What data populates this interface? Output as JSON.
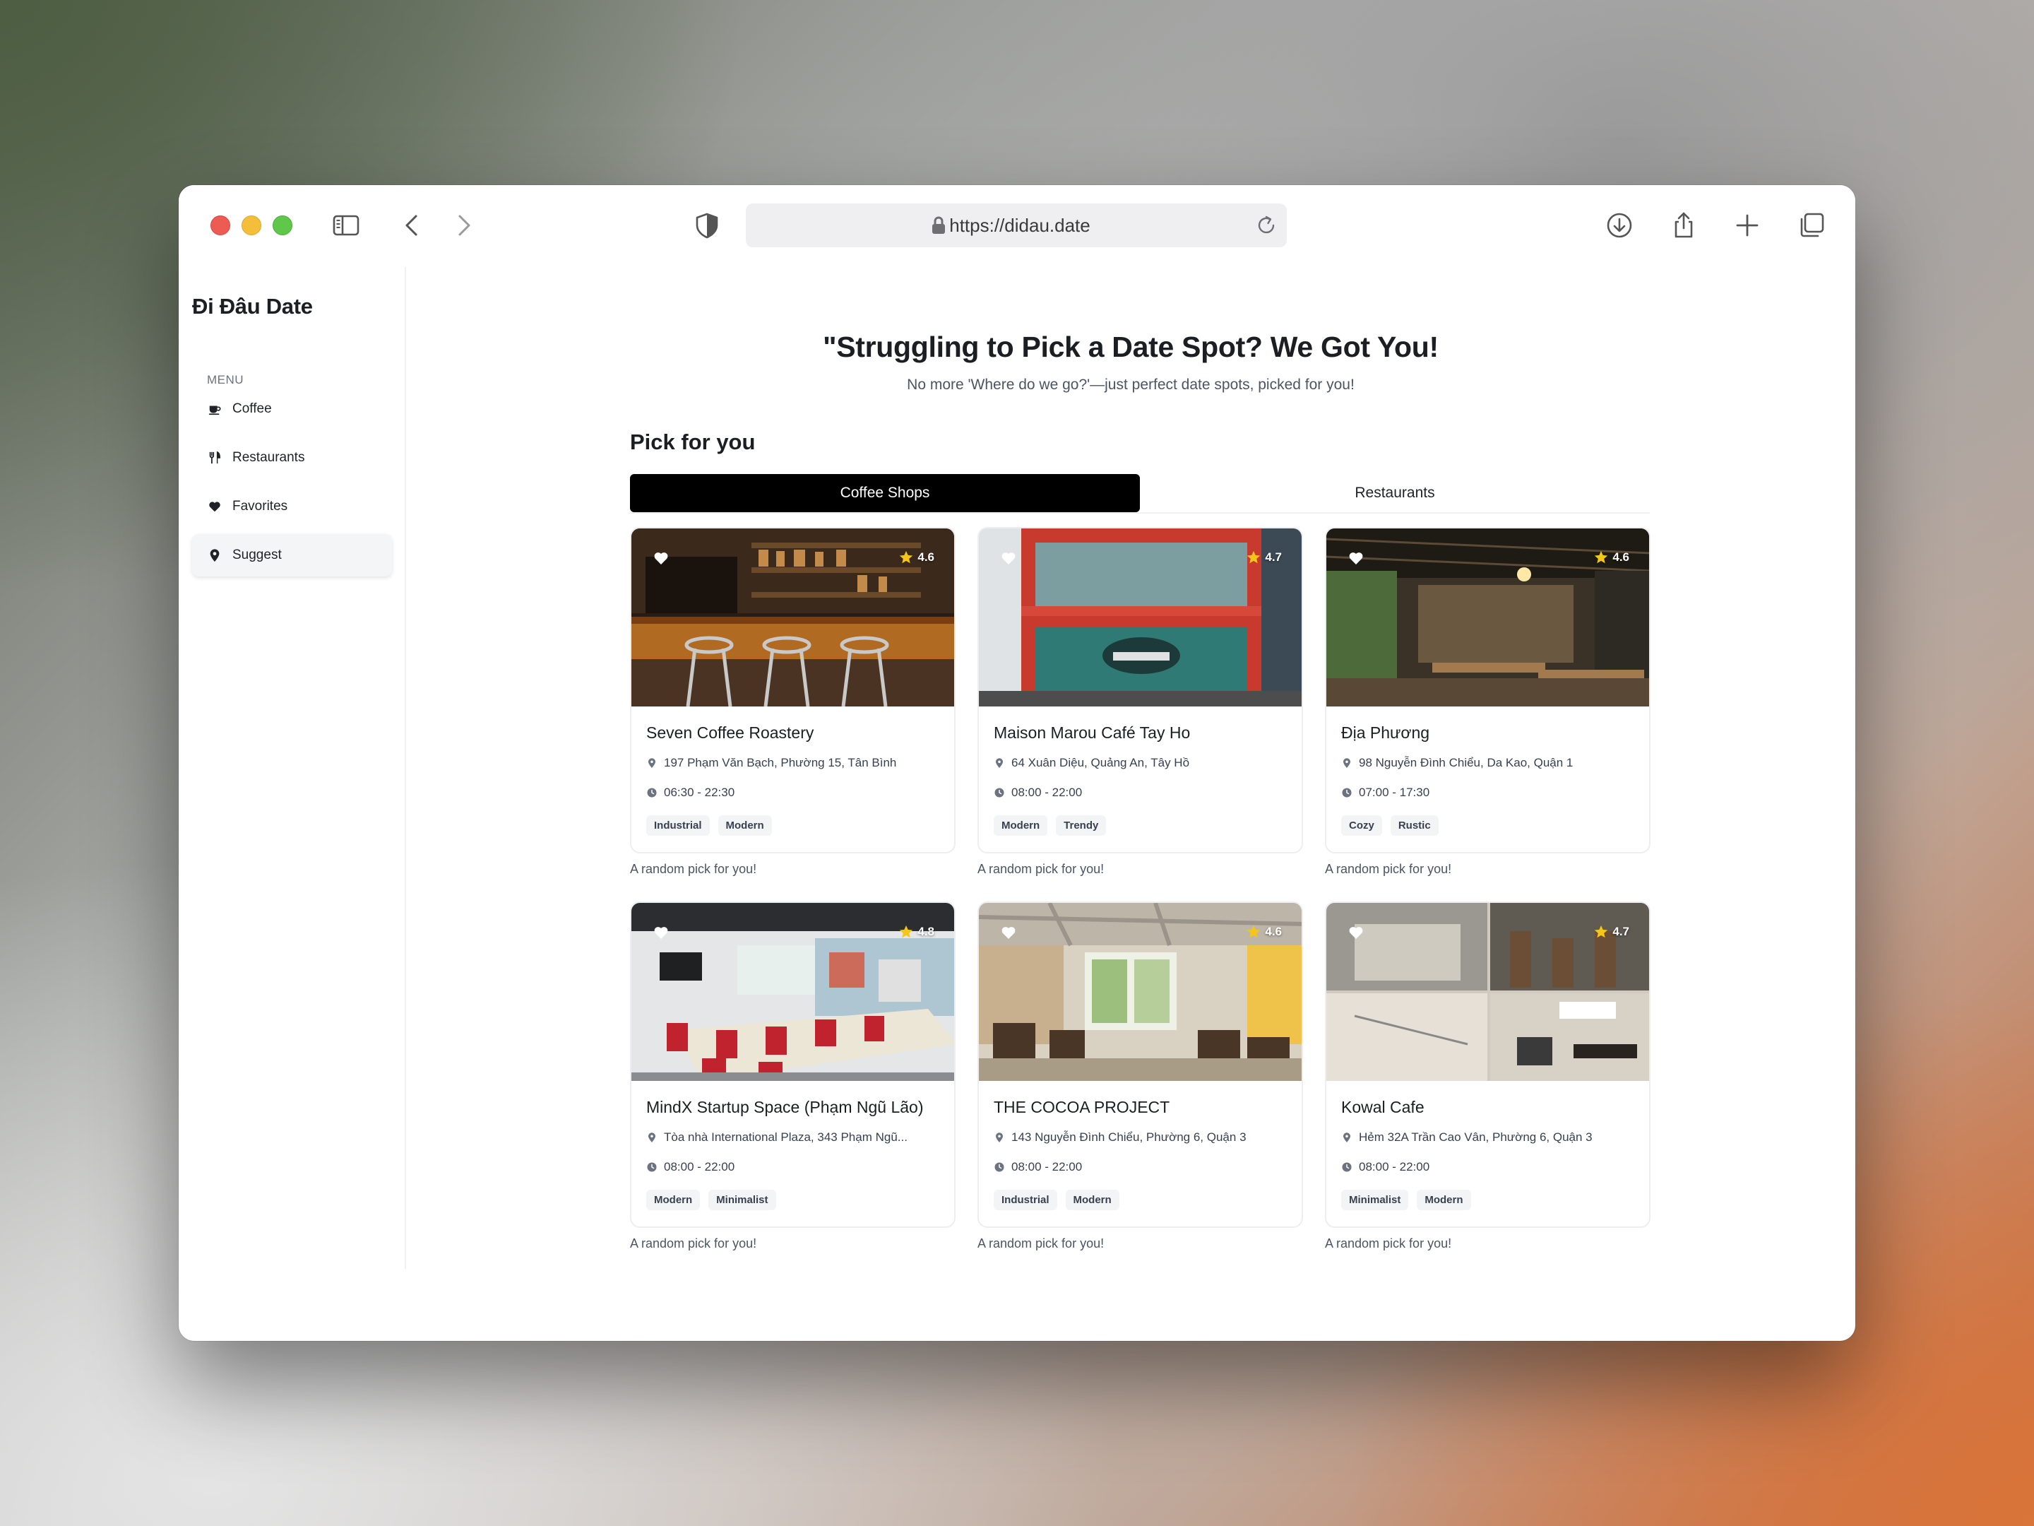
{
  "browser": {
    "url": "https://didau.date"
  },
  "sidebar": {
    "brand": "Đi Đâu Date",
    "menu_label": "MENU",
    "items": [
      {
        "label": "Coffee",
        "icon": "coffee-icon"
      },
      {
        "label": "Restaurants",
        "icon": "fork-knife-icon"
      },
      {
        "label": "Favorites",
        "icon": "heart-icon"
      },
      {
        "label": "Suggest",
        "icon": "map-pin-icon",
        "active": true
      }
    ]
  },
  "hero": {
    "title": "\"Struggling to Pick a Date Spot? We Got You!",
    "subtitle": "No more 'Where do we go?'—just perfect date spots, picked for you!"
  },
  "section": {
    "title": "Pick for you",
    "tabs": [
      {
        "label": "Coffee Shops",
        "active": true
      },
      {
        "label": "Restaurants",
        "active": false
      }
    ]
  },
  "cards": [
    {
      "name": "Seven Coffee Roastery",
      "rating": "4.6",
      "address": "197 Phạm Văn Bạch, Phường 15, Tân Bình",
      "hours": "06:30 - 22:30",
      "tags": [
        "Industrial",
        "Modern"
      ],
      "note": "A random pick for you!"
    },
    {
      "name": "Maison Marou Café Tay Ho",
      "rating": "4.7",
      "address": "64 Xuân Diệu, Quảng An, Tây Hồ",
      "hours": "08:00 - 22:00",
      "tags": [
        "Modern",
        "Trendy"
      ],
      "note": "A random pick for you!"
    },
    {
      "name": "Địa Phương",
      "rating": "4.6",
      "address": "98 Nguyễn Đình Chiểu, Da Kao, Quận 1",
      "hours": "07:00 - 17:30",
      "tags": [
        "Cozy",
        "Rustic"
      ],
      "note": "A random pick for you!"
    },
    {
      "name": "MindX Startup Space (Phạm Ngũ Lão)",
      "rating": "4.8",
      "address": "Tòa nhà International Plaza, 343 Phạm Ngũ...",
      "hours": "08:00 - 22:00",
      "tags": [
        "Modern",
        "Minimalist"
      ],
      "note": "A random pick for you!"
    },
    {
      "name": "THE COCOA PROJECT",
      "rating": "4.6",
      "address": "143 Nguyễn Đình Chiểu, Phường 6, Quận 3",
      "hours": "08:00 - 22:00",
      "tags": [
        "Industrial",
        "Modern"
      ],
      "note": "A random pick for you!"
    },
    {
      "name": "Kowal Cafe",
      "rating": "4.7",
      "address": "Hẻm 32A Trần Cao Vân, Phường 6, Quận 3",
      "hours": "08:00 - 22:00",
      "tags": [
        "Minimalist",
        "Modern"
      ],
      "note": "A random pick for you!"
    }
  ],
  "colors": {
    "accent": "#000000",
    "star": "#f5c518",
    "tag_bg": "#f3f4f6"
  }
}
